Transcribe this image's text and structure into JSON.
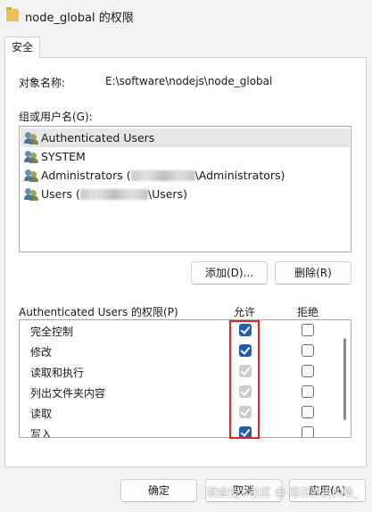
{
  "window": {
    "title": "node_global 的权限"
  },
  "tabs": [
    {
      "label": "安全"
    }
  ],
  "object": {
    "label": "对象名称:",
    "value": "E:\\software\\nodejs\\node_global"
  },
  "groups": {
    "label": "组或用户名(G):",
    "users": [
      {
        "prefix": "Authenticated Users",
        "suffix": ""
      },
      {
        "prefix": "SYSTEM",
        "suffix": ""
      },
      {
        "prefix": "Administrators (",
        "suffix": "\\Administrators)"
      },
      {
        "prefix": "Users (",
        "suffix": "\\Users)"
      }
    ]
  },
  "buttons": {
    "add": "添加(D)...",
    "remove": "删除(R)",
    "ok": "确定",
    "cancel": "取消",
    "apply": "应用(A)"
  },
  "permissions": {
    "label": "Authenticated Users 的权限(P)",
    "allow_header": "允许",
    "deny_header": "拒绝",
    "rows": [
      {
        "name": "完全控制",
        "allow": "checked",
        "deny": "unchecked"
      },
      {
        "name": "修改",
        "allow": "checked",
        "deny": "unchecked"
      },
      {
        "name": "读取和执行",
        "allow": "inherited-checked",
        "deny": "unchecked"
      },
      {
        "name": "列出文件夹内容",
        "allow": "inherited-checked",
        "deny": "unchecked"
      },
      {
        "name": "读取",
        "allow": "inherited-checked",
        "deny": "unchecked"
      },
      {
        "name": "写入",
        "allow": "checked",
        "deny": "unchecked"
      }
    ]
  },
  "colors": {
    "checkbox_checked": "#1f5eb3",
    "checkbox_inherited": "#cccccc",
    "highlight_box": "#e0262b"
  },
  "watermark": "掘金技术社区 @ 落日弥漫的橘_"
}
